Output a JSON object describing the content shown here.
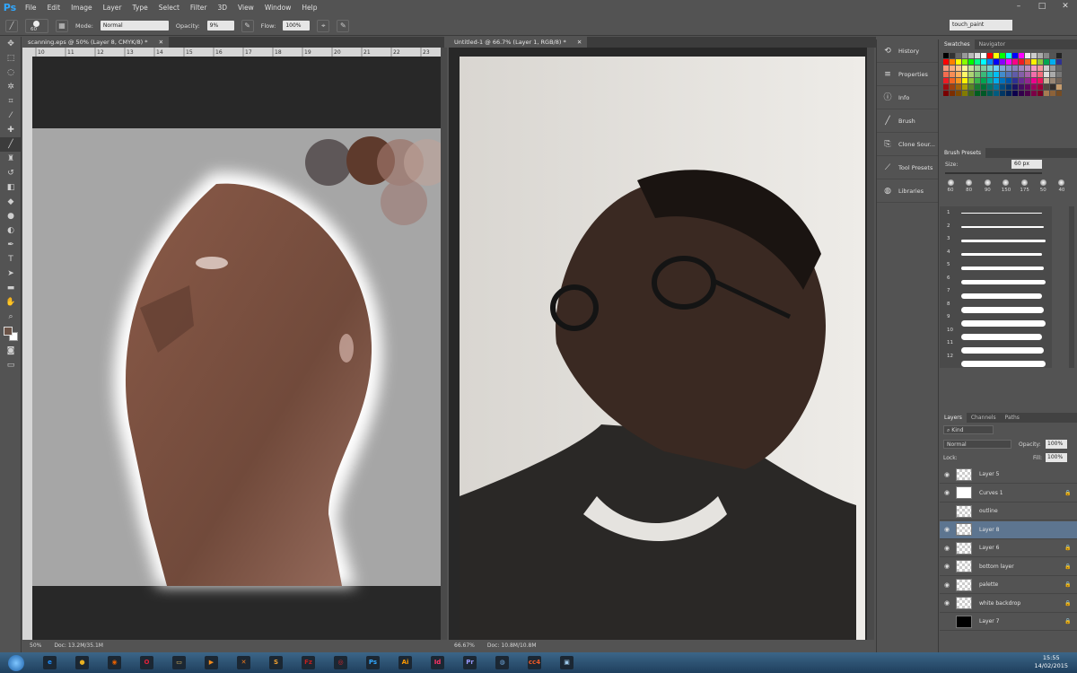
{
  "app": {
    "logo": "Ps"
  },
  "menu": [
    "File",
    "Edit",
    "Image",
    "Layer",
    "Type",
    "Select",
    "Filter",
    "3D",
    "View",
    "Window",
    "Help"
  ],
  "options_bar": {
    "brush_size": "60",
    "mode_label": "Mode:",
    "mode_value": "Normal",
    "opacity_label": "Opacity:",
    "opacity_value": "9%",
    "flow_label": "Flow:",
    "flow_value": "100%",
    "workspace": "touch_paint"
  },
  "documents": [
    {
      "tab": "scanning.eps @ 50% (Layer 8, CMYK/8) *",
      "zoom": "50%",
      "doc_size": "Doc: 13.2M/35.1M",
      "ruler_ticks": [
        "10",
        "11",
        "12",
        "13",
        "14",
        "15",
        "16",
        "17",
        "18",
        "19",
        "20",
        "21",
        "22",
        "23"
      ]
    },
    {
      "tab": "Untitled-1 @ 66.7% (Layer 1, RGB/8) *",
      "zoom": "66.67%",
      "doc_size": "Doc: 10.8M/10.8M"
    }
  ],
  "dock_panels": [
    {
      "label": "History",
      "icon": "history-icon"
    },
    {
      "label": "Properties",
      "icon": "properties-icon"
    },
    {
      "label": "Info",
      "icon": "info-icon"
    },
    {
      "label": "Brush",
      "icon": "brush-icon"
    },
    {
      "label": "Clone Sour...",
      "icon": "clone-source-icon"
    },
    {
      "label": "Tool Presets",
      "icon": "tool-presets-icon"
    },
    {
      "label": "Libraries",
      "icon": "libraries-icon"
    }
  ],
  "swatches_panel": {
    "tabs": [
      "Swatches",
      "Navigator"
    ]
  },
  "brush_presets": {
    "title": "Brush Presets",
    "size_label": "Size:",
    "size_value": "60 px",
    "tip_sizes": [
      "60",
      "80",
      "90",
      "150",
      "175",
      "50",
      "40"
    ],
    "stroke_numbers": [
      "1",
      "2",
      "3",
      "4",
      "5",
      "6",
      "7",
      "8",
      "9",
      "10",
      "11",
      "12"
    ]
  },
  "layers_panel": {
    "tabs": [
      "Layers",
      "Channels",
      "Paths"
    ],
    "kind_label": "Kind",
    "blend_mode": "Normal",
    "opacity_label": "Opacity:",
    "opacity_value": "100%",
    "lock_label": "Lock:",
    "fill_label": "Fill:",
    "fill_value": "100%",
    "layers": [
      {
        "name": "Layer 5",
        "selected": false,
        "visible": true
      },
      {
        "name": "Curves 1",
        "selected": false,
        "visible": true
      },
      {
        "name": "outline",
        "selected": false,
        "visible": false
      },
      {
        "name": "Layer 8",
        "selected": true,
        "visible": true
      },
      {
        "name": "Layer 6",
        "selected": false,
        "visible": true
      },
      {
        "name": "bottom layer",
        "selected": false,
        "visible": true
      },
      {
        "name": "palette",
        "selected": false,
        "visible": true
      },
      {
        "name": "white backdrop",
        "selected": false,
        "visible": true
      },
      {
        "name": "Layer 7",
        "selected": false,
        "visible": false
      }
    ]
  },
  "taskbar": {
    "apps": [
      {
        "name": "internet-explorer-icon",
        "glyph": "e",
        "color": "#1e90ff"
      },
      {
        "name": "chrome-icon",
        "glyph": "●",
        "color": "#e8b021"
      },
      {
        "name": "firefox-icon",
        "glyph": "◉",
        "color": "#e66000"
      },
      {
        "name": "opera-icon",
        "glyph": "O",
        "color": "#e0203a"
      },
      {
        "name": "folder-icon",
        "glyph": "▭",
        "color": "#e8c060"
      },
      {
        "name": "media-player-icon",
        "glyph": "▶",
        "color": "#f08a1c"
      },
      {
        "name": "xampp-icon",
        "glyph": "✕",
        "color": "#f07a1c"
      },
      {
        "name": "sublime-icon",
        "glyph": "S",
        "color": "#f0a030"
      },
      {
        "name": "filezilla-icon",
        "glyph": "Fz",
        "color": "#c02020"
      },
      {
        "name": "creative-cloud-icon",
        "glyph": "◎",
        "color": "#d8262b"
      },
      {
        "name": "photoshop-icon",
        "glyph": "Ps",
        "color": "#31a8ff"
      },
      {
        "name": "illustrator-icon",
        "glyph": "Ai",
        "color": "#ff9a00"
      },
      {
        "name": "indesign-icon",
        "glyph": "Id",
        "color": "#ff3366"
      },
      {
        "name": "premiere-icon",
        "glyph": "Pr",
        "color": "#9999ff"
      },
      {
        "name": "network-icon",
        "glyph": "◍",
        "color": "#6fa8dc"
      },
      {
        "name": "cc4-icon",
        "glyph": "cc4",
        "color": "#f05a28"
      },
      {
        "name": "monitor-icon",
        "glyph": "▣",
        "color": "#9cc8e8"
      }
    ],
    "time": "15:55",
    "date": "14/02/2015"
  }
}
